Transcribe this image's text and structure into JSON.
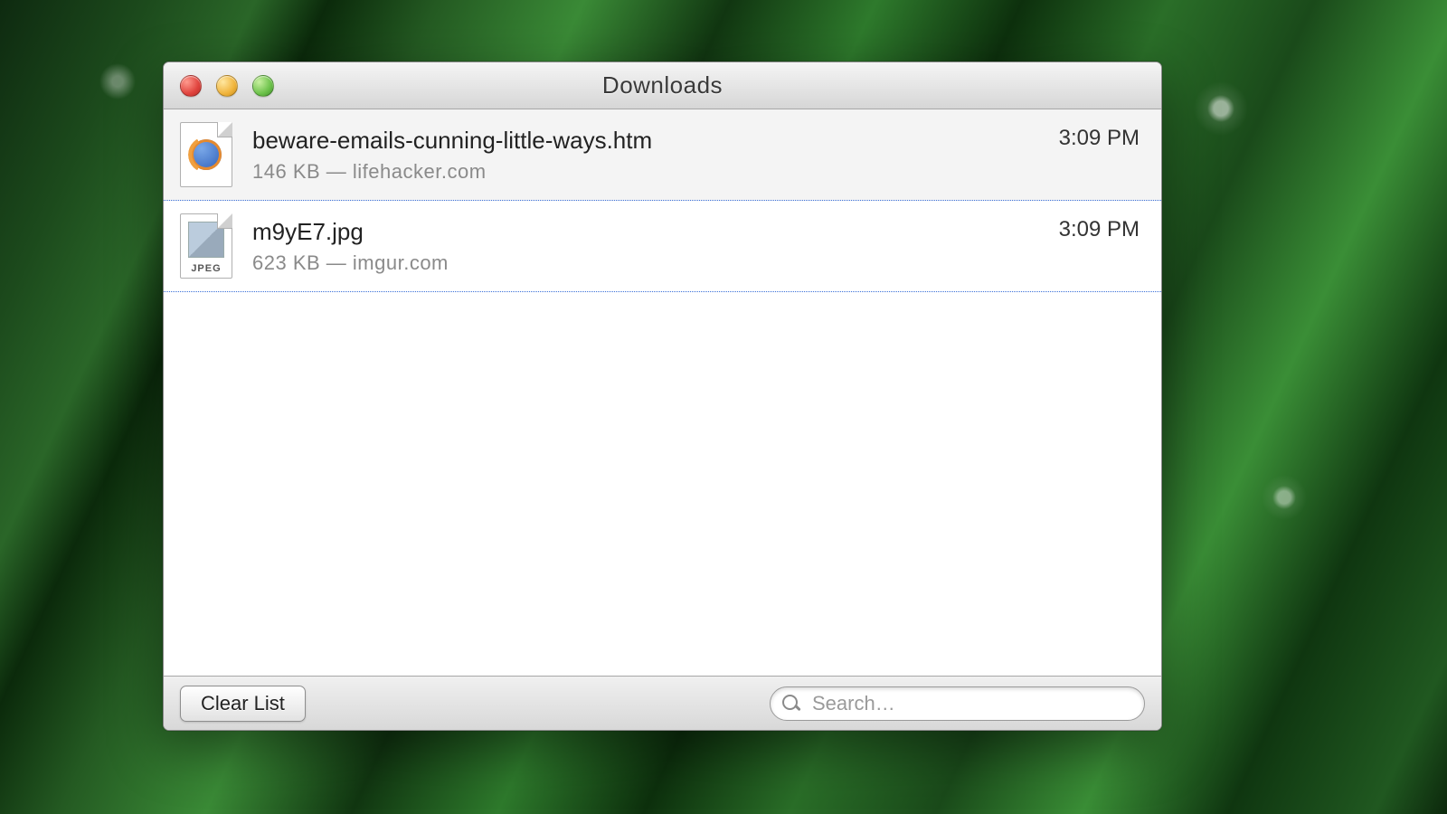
{
  "window": {
    "title": "Downloads"
  },
  "downloads": [
    {
      "icon": "html-file-icon",
      "filename": "beware-emails-cunning-little-ways.htm",
      "size": "146 KB",
      "source": "lifehacker.com",
      "time": "3:09 PM",
      "selected": false
    },
    {
      "icon": "jpeg-file-icon",
      "icon_label": "JPEG",
      "filename": "m9yE7.jpg",
      "size": "623 KB",
      "source": "imgur.com",
      "time": "3:09 PM",
      "selected": true
    }
  ],
  "toolbar": {
    "clear_label": "Clear List"
  },
  "search": {
    "placeholder": "Search…",
    "value": ""
  }
}
